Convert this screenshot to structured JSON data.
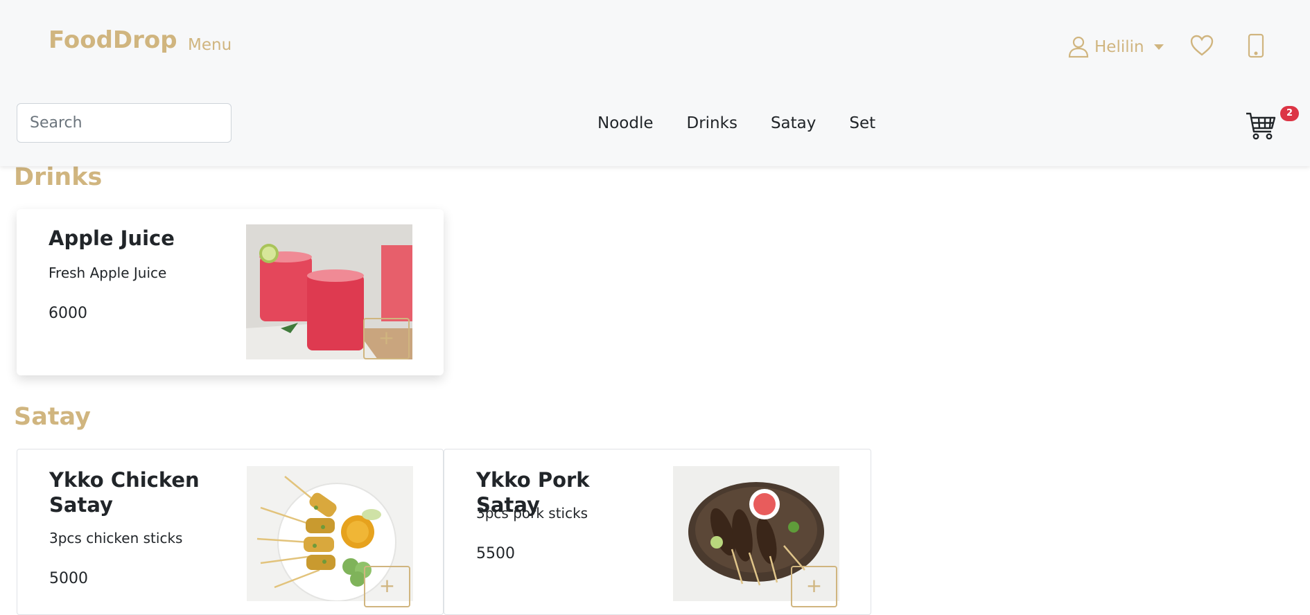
{
  "header": {
    "brand": "FoodDrop",
    "menu_label": "Menu",
    "user_name": "Helilin",
    "search_placeholder": "Search",
    "search_value": "",
    "cart_count": "2",
    "nav": [
      "Noodle",
      "Drinks",
      "Satay",
      "Set"
    ]
  },
  "sections": [
    {
      "title": "Drinks",
      "items": [
        {
          "name": "Apple Juice",
          "description": "Fresh Apple Juice",
          "price": "6000",
          "add_label": "+"
        }
      ]
    },
    {
      "title": "Satay",
      "items": [
        {
          "name": "Ykko Chicken Satay",
          "description": "3pcs chicken sticks",
          "price": "5000",
          "add_label": "+"
        },
        {
          "name": "Ykko Pork Satay",
          "description": "3pcs pork sticks",
          "price": "5500",
          "add_label": "+"
        }
      ]
    }
  ],
  "colors": {
    "brand": "#d0b57f",
    "badge": "#dc3545",
    "header_bg": "#f7f8f9"
  },
  "icons": [
    "user-icon",
    "heart-icon",
    "phone-icon",
    "cart-icon",
    "plus-icon"
  ]
}
